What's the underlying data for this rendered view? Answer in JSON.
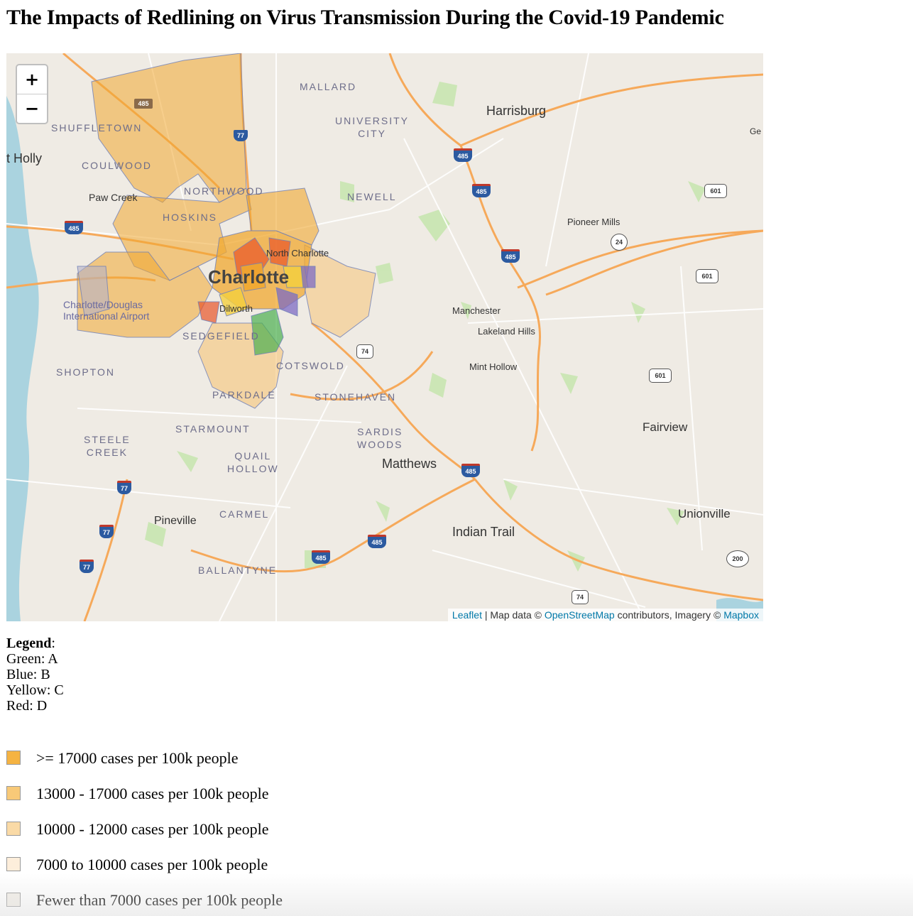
{
  "title": "The Impacts of Redlining on Virus Transmission During the Covid-19 Pandemic",
  "map": {
    "zoom_in": "+",
    "zoom_out": "−",
    "attribution": {
      "leaflet": "Leaflet",
      "sep1": " | Map data © ",
      "osm": "OpenStreetMap",
      "sep2": " contributors, Imagery © ",
      "mapbox": "Mapbox"
    },
    "labels": {
      "mallard": "MALLARD",
      "university_city": "UNIVERSITY\nCITY",
      "harrisburg": "Harrisburg",
      "shuffletown": "SHUFFLETOWN",
      "mount_holly": "t Holly",
      "coulwood": "COULWOOD",
      "northwood": "NORTHWOOD",
      "newell": "NEWELL",
      "paw_creek": "Paw Creek",
      "hoskins": "HOSKINS",
      "pioneer_mills": "Pioneer Mills",
      "north_charlotte": "North Charlotte",
      "charlotte": "Charlotte",
      "airport": "Charlotte/Douglas\nInternational Airport",
      "dilworth": "Dilworth",
      "manchester": "Manchester",
      "lakeland_hills": "Lakeland Hills",
      "sedgefield": "SEDGEFIELD",
      "shopton": "SHOPTON",
      "cotswold": "COTSWOLD",
      "mint_hollow": "Mint Hollow",
      "parkdale": "PARKDALE",
      "stonehaven": "STONEHAVEN",
      "starmount": "STARMOUNT",
      "fairview": "Fairview",
      "sardis_woods": "SARDIS\nWOODS",
      "steele_creek": "STEELE\nCREEK",
      "quail_hollow": "QUAIL\nHOLLOW",
      "matthews": "Matthews",
      "carmel": "CARMEL",
      "pineville": "Pineville",
      "unionville": "Unionville",
      "indian_trail": "Indian Trail",
      "ballantyne": "BALLANTYNE",
      "georgeville": "Ge"
    },
    "shields": {
      "i485": "485",
      "i77": "77",
      "us74": "74",
      "us601": "601",
      "nc24": "24",
      "nc200": "200"
    },
    "colors": {
      "high_cases": "#f5b041",
      "mid_cases": "#f8c471",
      "lower_cases": "#fad7a0",
      "holc_a": "#4caf50",
      "holc_b": "#5c6bc0",
      "holc_c": "#f4d03f",
      "holc_d": "#e8562a"
    }
  },
  "legend": {
    "heading": "Legend",
    "items": [
      "Green: A",
      "Blue: B",
      "Yellow: C",
      "Red: D"
    ]
  },
  "bins": [
    {
      "label": ">= 17000 cases per 100k people",
      "color": "#f5b342"
    },
    {
      "label": "13000 - 17000 cases per 100k people",
      "color": "#f8c978"
    },
    {
      "label": "10000 - 12000 cases per 100k people",
      "color": "#fadaa6"
    },
    {
      "label": "7000 to 10000 cases per 100k people",
      "color": "#fdeedb"
    },
    {
      "label": "Fewer than 7000 cases per 100k people",
      "color": "#f3efe8"
    }
  ]
}
